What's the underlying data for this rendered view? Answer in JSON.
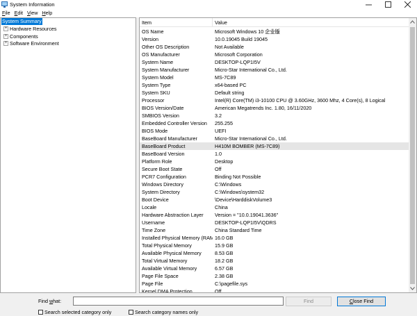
{
  "window": {
    "title": "System Information",
    "icon": "system-information-icon"
  },
  "menu": [
    "File",
    "Edit",
    "View",
    "Help"
  ],
  "tree": {
    "root": "System Summary",
    "children": [
      "Hardware Resources",
      "Components",
      "Software Environment"
    ]
  },
  "columns": {
    "item": "Item",
    "value": "Value"
  },
  "rows": [
    {
      "item": "OS Name",
      "value": "Microsoft Windows 10 企业版"
    },
    {
      "item": "Version",
      "value": "10.0.19045 Build 19045"
    },
    {
      "item": "Other OS Description",
      "value": "Not Available"
    },
    {
      "item": "OS Manufacturer",
      "value": "Microsoft Corporation"
    },
    {
      "item": "System Name",
      "value": "DESKTOP-LQP1I5V"
    },
    {
      "item": "System Manufacturer",
      "value": "Micro-Star International Co., Ltd."
    },
    {
      "item": "System Model",
      "value": "MS-7C89"
    },
    {
      "item": "System Type",
      "value": "x64-based PC"
    },
    {
      "item": "System SKU",
      "value": "Default string"
    },
    {
      "item": "Processor",
      "value": "Intel(R) Core(TM) i3-10100 CPU @ 3.60GHz, 3600 Mhz, 4 Core(s), 8 Logical Pr..."
    },
    {
      "item": "BIOS Version/Date",
      "value": "American Megatrends Inc. 1.80, 16/11/2020"
    },
    {
      "item": "SMBIOS Version",
      "value": "3.2"
    },
    {
      "item": "Embedded Controller Version",
      "value": "255.255"
    },
    {
      "item": "BIOS Mode",
      "value": "UEFI"
    },
    {
      "item": "BaseBoard Manufacturer",
      "value": "Micro-Star International Co., Ltd."
    },
    {
      "item": "BaseBoard Product",
      "value": "H410M BOMBER (MS-7C89)"
    },
    {
      "item": "BaseBoard Version",
      "value": "1.0"
    },
    {
      "item": "Platform Role",
      "value": "Desktop"
    },
    {
      "item": "Secure Boot State",
      "value": "Off"
    },
    {
      "item": "PCR7 Configuration",
      "value": "Binding Not Possible"
    },
    {
      "item": "Windows Directory",
      "value": "C:\\Windows"
    },
    {
      "item": "System Directory",
      "value": "C:\\Windows\\system32"
    },
    {
      "item": "Boot Device",
      "value": "\\Device\\HarddiskVolume3"
    },
    {
      "item": "Locale",
      "value": "China"
    },
    {
      "item": "Hardware Abstraction Layer",
      "value": "Version = \"10.0.19041.3636\""
    },
    {
      "item": "Username",
      "value": "DESKTOP-LQP1I5V\\QDRS"
    },
    {
      "item": "Time Zone",
      "value": "China Standard Time"
    },
    {
      "item": "Installed Physical Memory (RAM)",
      "value": "16.0 GB"
    },
    {
      "item": "Total Physical Memory",
      "value": "15.9 GB"
    },
    {
      "item": "Available Physical Memory",
      "value": "8.53 GB"
    },
    {
      "item": "Total Virtual Memory",
      "value": "18.2 GB"
    },
    {
      "item": "Available Virtual Memory",
      "value": "6.57 GB"
    },
    {
      "item": "Page File Space",
      "value": "2.38 GB"
    },
    {
      "item": "Page File",
      "value": "C:\\pagefile.sys"
    },
    {
      "item": "Kernel DMA Protection",
      "value": "Off"
    }
  ],
  "highlighted_row": "BaseBoard Product",
  "find": {
    "label": "Find what:",
    "value": "",
    "find_button": "Find",
    "close_button": "Close Find",
    "option1": "Search selected category only",
    "option2": "Search category names only"
  },
  "colors": {
    "selection": "#0078d7",
    "row_highlight": "#e5e5e5",
    "chrome": "#f0f0f0"
  }
}
